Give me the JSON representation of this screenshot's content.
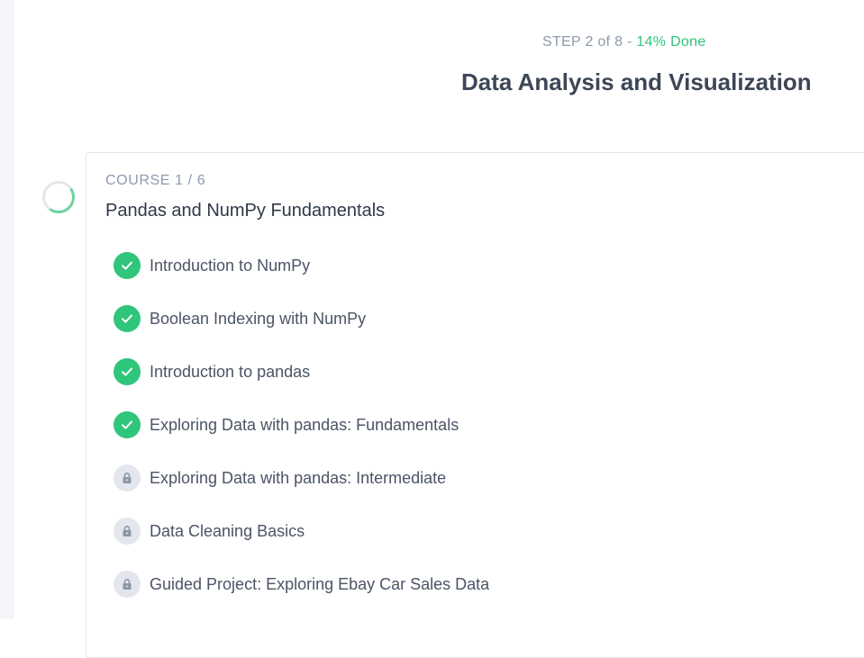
{
  "header": {
    "step_prefix": "STEP 2 of 8 - ",
    "progress_text": "14% Done",
    "title": "Data Analysis and Visualization"
  },
  "course": {
    "counter": "COURSE 1 / 6",
    "title": "Pandas and NumPy Fundamentals",
    "progress_fraction": 0.14,
    "lessons": [
      {
        "label": "Introduction to NumPy",
        "status": "completed",
        "icon": "check-icon"
      },
      {
        "label": "Boolean Indexing with NumPy",
        "status": "completed",
        "icon": "check-icon"
      },
      {
        "label": "Introduction to pandas",
        "status": "completed",
        "icon": "check-icon"
      },
      {
        "label": "Exploring Data with pandas: Fundamentals",
        "status": "completed",
        "icon": "check-icon"
      },
      {
        "label": "Exploring Data with pandas: Intermediate",
        "status": "locked",
        "icon": "lock-icon"
      },
      {
        "label": "Data Cleaning Basics",
        "status": "locked",
        "icon": "lock-icon"
      },
      {
        "label": "Guided Project: Exploring Ebay Car Sales Data",
        "status": "locked",
        "icon": "lock-icon"
      }
    ]
  },
  "colors": {
    "accent_green": "#2fc57a",
    "muted_text": "#8e9aae",
    "title_text": "#3d4657",
    "locked_badge": "#e3e6ec"
  }
}
